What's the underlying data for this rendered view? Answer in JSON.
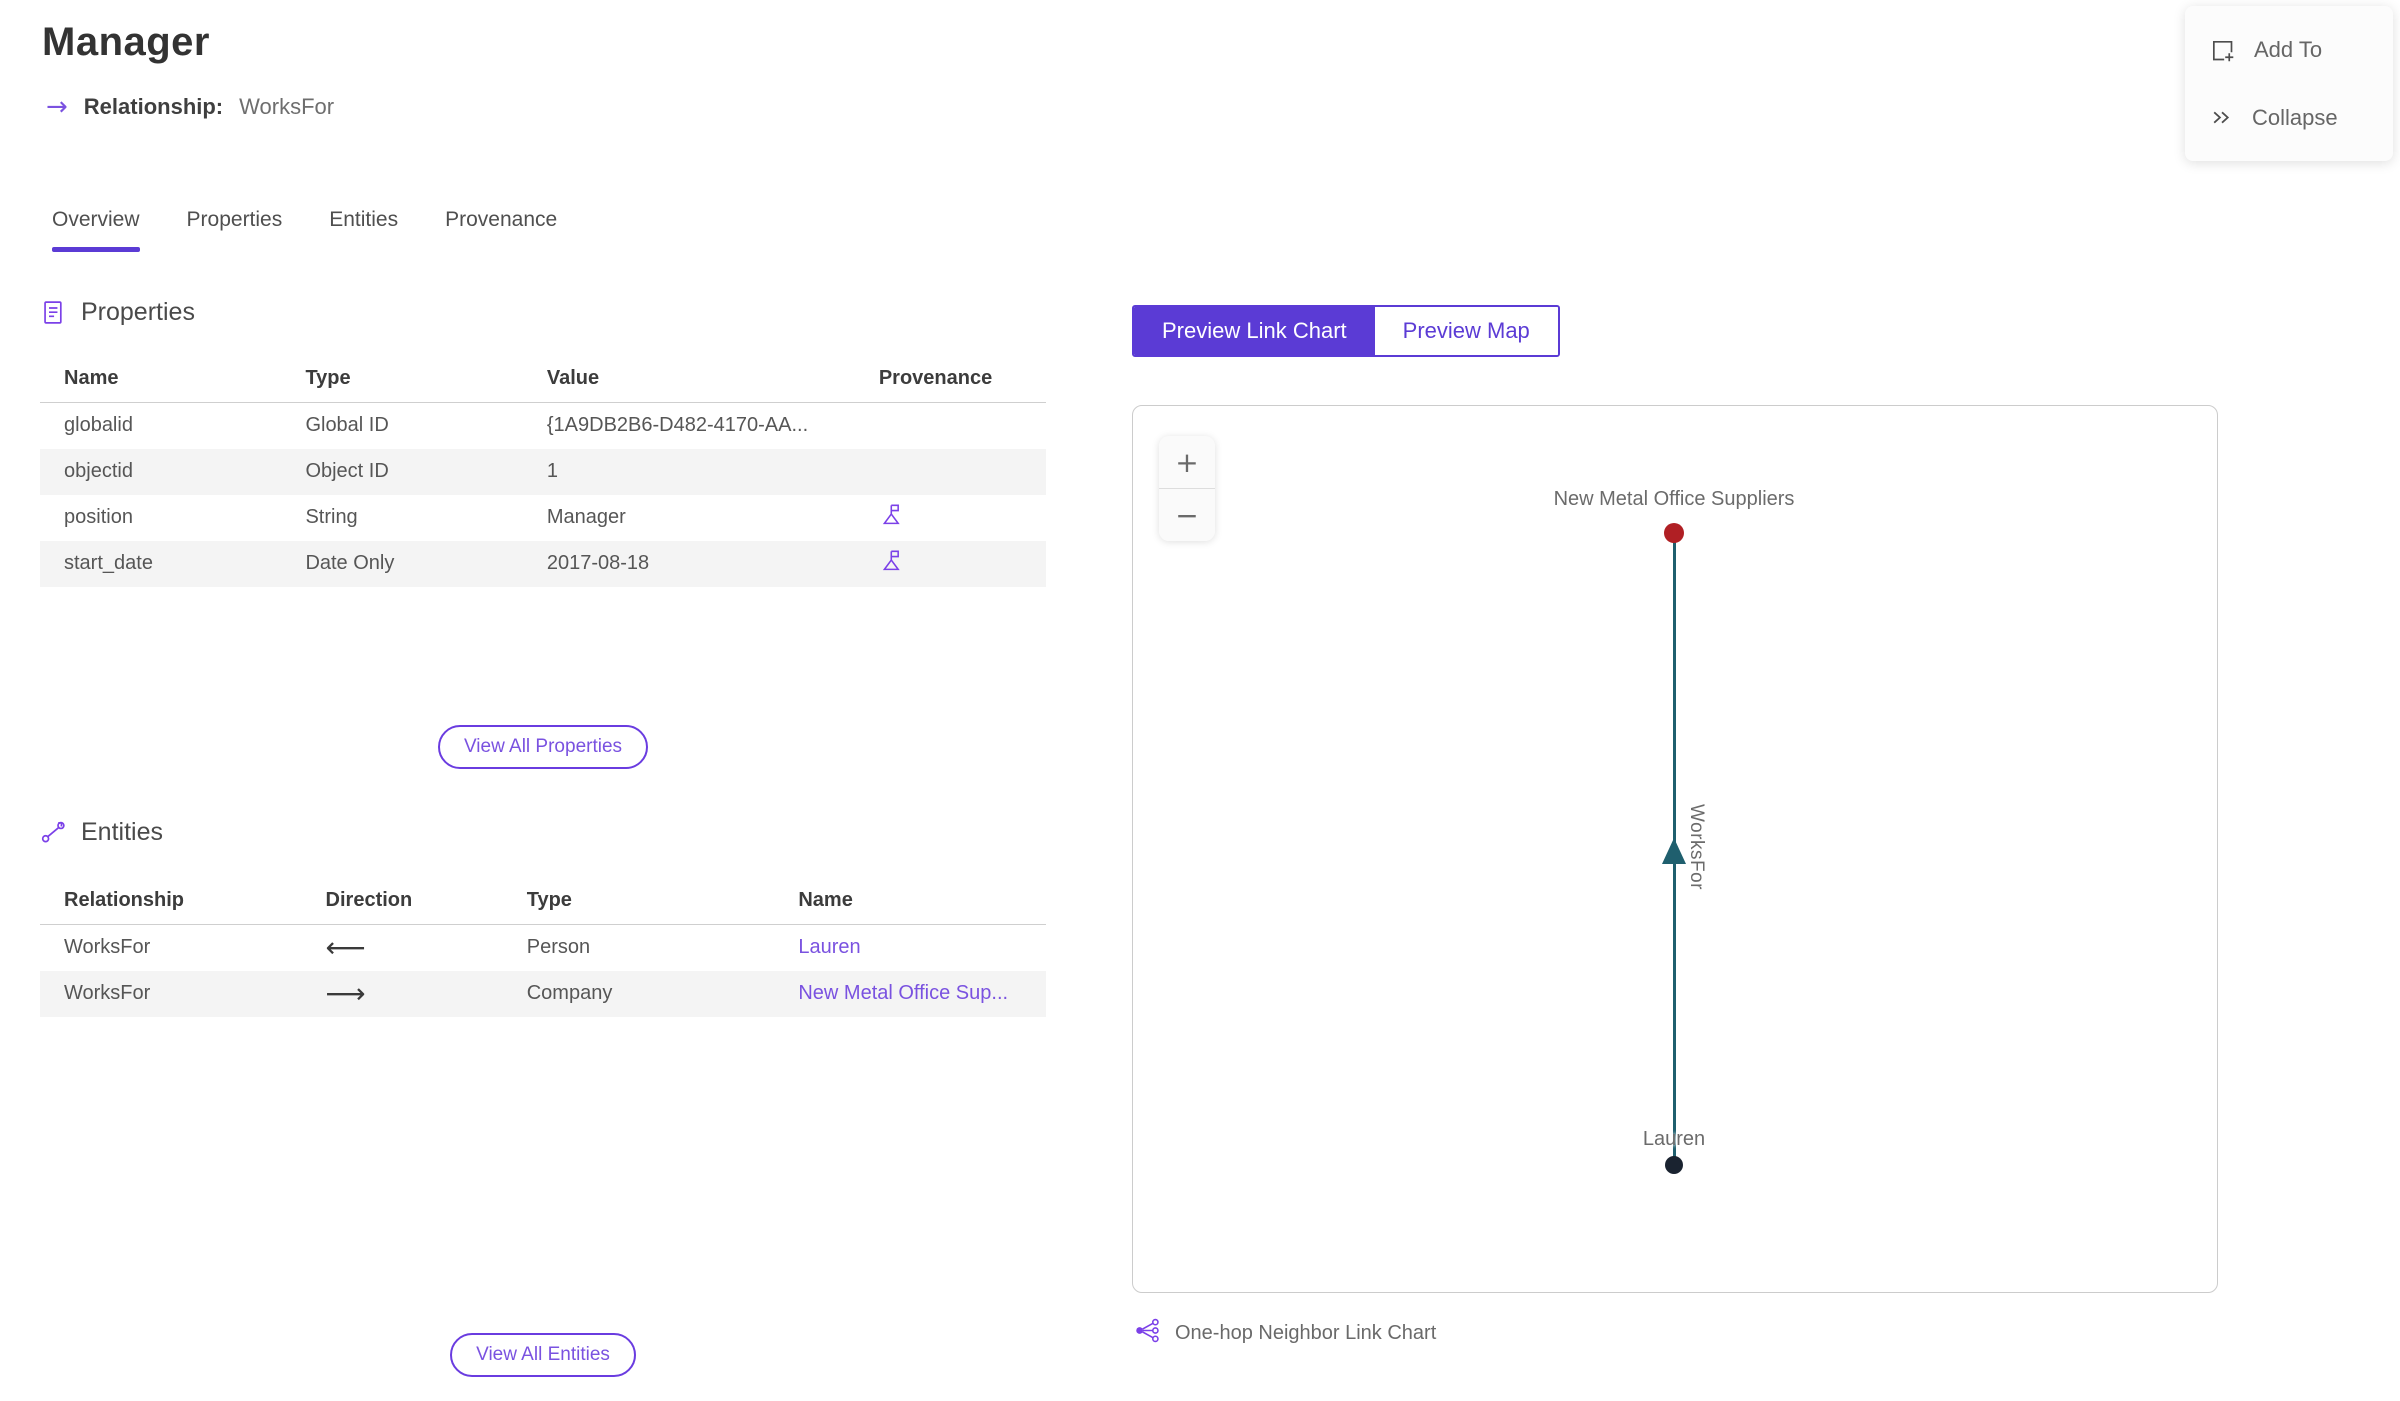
{
  "header": {
    "title": "Manager",
    "arrow_icon": "→",
    "subtitle_label": "Relationship:",
    "subtitle_value": "WorksFor"
  },
  "tabs": [
    {
      "label": "Overview",
      "active": true
    },
    {
      "label": "Properties",
      "active": false
    },
    {
      "label": "Entities",
      "active": false
    },
    {
      "label": "Provenance",
      "active": false
    }
  ],
  "properties_section": {
    "title": "Properties",
    "columns": {
      "name": "Name",
      "type": "Type",
      "value": "Value",
      "provenance": "Provenance"
    },
    "rows": [
      {
        "name": "globalid",
        "type": "Global ID",
        "value": "{1A9DB2B6-D482-4170-AA...",
        "provenance": false
      },
      {
        "name": "objectid",
        "type": "Object ID",
        "value": "1",
        "provenance": false
      },
      {
        "name": "position",
        "type": "String",
        "value": "Manager",
        "provenance": true
      },
      {
        "name": "start_date",
        "type": "Date Only",
        "value": "2017-08-18",
        "provenance": true
      }
    ],
    "view_all_label": "View All Properties"
  },
  "entities_section": {
    "title": "Entities",
    "columns": {
      "relationship": "Relationship",
      "direction": "Direction",
      "type": "Type",
      "name": "Name"
    },
    "rows": [
      {
        "relationship": "WorksFor",
        "direction": "⟵",
        "type": "Person",
        "name": "Lauren"
      },
      {
        "relationship": "WorksFor",
        "direction": "⟶",
        "type": "Company",
        "name": "New Metal Office Sup..."
      }
    ],
    "view_all_label": "View All Entities"
  },
  "preview": {
    "toggle": {
      "link_chart": "Preview Link Chart",
      "map": "Preview Map"
    },
    "zoom_in": "+",
    "zoom_out": "−",
    "caption": "One-hop Neighbor Link Chart",
    "chart": {
      "type": "link-chart",
      "nodes": [
        {
          "label": "New Metal Office Suppliers",
          "color": "#B01F24",
          "position": "top"
        },
        {
          "label": "Lauren",
          "color": "#1A2330",
          "position": "bottom"
        }
      ],
      "edge": {
        "label": "WorksFor",
        "from": "Lauren",
        "to": "New Metal Office Suppliers",
        "color": "#1F5F6E",
        "arrow_direction": "up"
      }
    }
  },
  "floating_panel": {
    "add_to": "Add To",
    "collapse": "Collapse"
  },
  "colors": {
    "accent_purple": "#5B3BD5",
    "link_purple": "#7A52E0",
    "icon_purple": "#7B40E8",
    "edge_teal": "#1F5F6E",
    "node_red": "#B01F24",
    "node_navy": "#1A2330",
    "alt_row": "#F4F4F4"
  }
}
